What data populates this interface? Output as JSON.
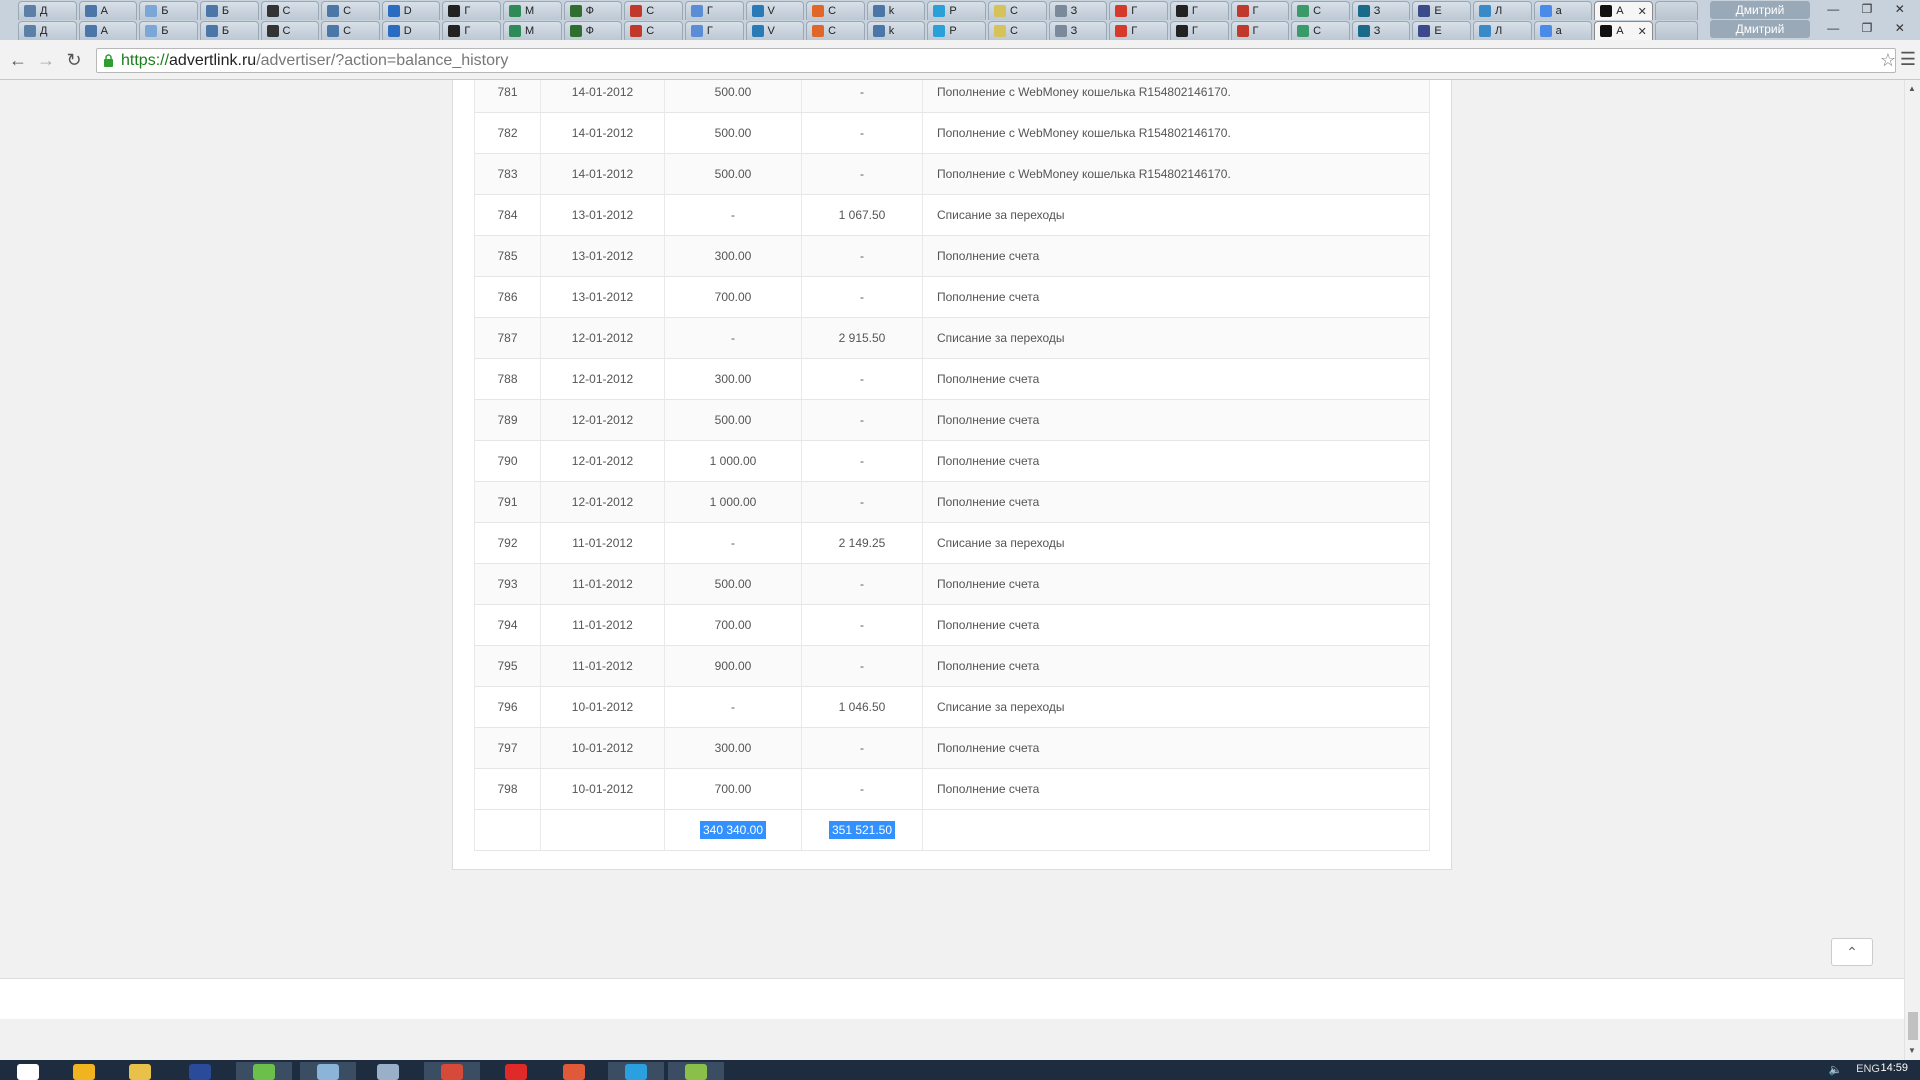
{
  "browser": {
    "tabs_row1": [
      {
        "label": "Д",
        "color": "#5b7fa6"
      },
      {
        "label": "А",
        "color": "#4a76a8"
      },
      {
        "label": "Б",
        "color": "#7aa7d8"
      },
      {
        "label": "Б",
        "color": "#4a76a8"
      },
      {
        "label": "С",
        "color": "#333333"
      },
      {
        "label": "С",
        "color": "#4a76a8"
      },
      {
        "label": "D",
        "color": "#2a6cc2"
      },
      {
        "label": "Г",
        "color": "#222222"
      },
      {
        "label": "М",
        "color": "#2e8b57"
      },
      {
        "label": "Ф",
        "color": "#2f6e2f"
      },
      {
        "label": "С",
        "color": "#c0392b"
      },
      {
        "label": "Г",
        "color": "#5b8dd6"
      },
      {
        "label": "V",
        "color": "#2a7ab8"
      },
      {
        "label": "С",
        "color": "#e0662a"
      },
      {
        "label": "k",
        "color": "#4a76a8"
      },
      {
        "label": "Р",
        "color": "#2aa0d8"
      },
      {
        "label": "С",
        "color": "#d6c25b"
      },
      {
        "label": "З",
        "color": "#7a8a9a"
      },
      {
        "label": "Г",
        "color": "#d63a2a"
      },
      {
        "label": "Г",
        "color": "#222222"
      },
      {
        "label": "Г",
        "color": "#c0392b"
      },
      {
        "label": "С",
        "color": "#3a9a6a"
      },
      {
        "label": "З",
        "color": "#1a6a8a"
      },
      {
        "label": "E",
        "color": "#3a4a8a"
      },
      {
        "label": "Л",
        "color": "#3a8ac8"
      },
      {
        "label": "а",
        "color": "#4a8ae8"
      },
      {
        "label": "А",
        "color": "#111111"
      }
    ],
    "tabs_row2": [
      {
        "label": "Д",
        "color": "#5b7fa6"
      },
      {
        "label": "А",
        "color": "#4a76a8"
      },
      {
        "label": "Б",
        "color": "#7aa7d8"
      },
      {
        "label": "Б",
        "color": "#4a76a8"
      },
      {
        "label": "С",
        "color": "#333333"
      },
      {
        "label": "С",
        "color": "#4a76a8"
      },
      {
        "label": "D",
        "color": "#2a6cc2"
      },
      {
        "label": "Г",
        "color": "#222222"
      },
      {
        "label": "М",
        "color": "#2e8b57"
      },
      {
        "label": "Ф",
        "color": "#2f6e2f"
      },
      {
        "label": "С",
        "color": "#c0392b"
      },
      {
        "label": "Г",
        "color": "#5b8dd6"
      },
      {
        "label": "V",
        "color": "#2a7ab8"
      },
      {
        "label": "С",
        "color": "#e0662a"
      },
      {
        "label": "k",
        "color": "#4a76a8"
      },
      {
        "label": "Р",
        "color": "#2aa0d8"
      },
      {
        "label": "С",
        "color": "#d6c25b"
      },
      {
        "label": "З",
        "color": "#7a8a9a"
      },
      {
        "label": "Г",
        "color": "#d63a2a"
      },
      {
        "label": "Г",
        "color": "#222222"
      },
      {
        "label": "Г",
        "color": "#c0392b"
      },
      {
        "label": "С",
        "color": "#3a9a6a"
      },
      {
        "label": "З",
        "color": "#1a6a8a"
      },
      {
        "label": "E",
        "color": "#3a4a8a"
      },
      {
        "label": "Л",
        "color": "#3a8ac8"
      },
      {
        "label": "а",
        "color": "#4a8ae8"
      },
      {
        "label": "А",
        "color": "#111111"
      }
    ],
    "user_name": "Дмитрий",
    "url_scheme": "https://",
    "url_domain": "advertlink.ru",
    "url_path": "/advertiser/?action=balance_history"
  },
  "table": {
    "rows": [
      {
        "id": "781",
        "date": "14-01-2012",
        "credit": "500.00",
        "debit": "-",
        "desc": "Пополнение с WebMoney кошелька R154802146170."
      },
      {
        "id": "782",
        "date": "14-01-2012",
        "credit": "500.00",
        "debit": "-",
        "desc": "Пополнение с WebMoney кошелька R154802146170."
      },
      {
        "id": "783",
        "date": "14-01-2012",
        "credit": "500.00",
        "debit": "-",
        "desc": "Пополнение с WebMoney кошелька R154802146170."
      },
      {
        "id": "784",
        "date": "13-01-2012",
        "credit": "-",
        "debit": "1 067.50",
        "desc": "Списание за переходы"
      },
      {
        "id": "785",
        "date": "13-01-2012",
        "credit": "300.00",
        "debit": "-",
        "desc": "Пополнение счета"
      },
      {
        "id": "786",
        "date": "13-01-2012",
        "credit": "700.00",
        "debit": "-",
        "desc": "Пополнение счета"
      },
      {
        "id": "787",
        "date": "12-01-2012",
        "credit": "-",
        "debit": "2 915.50",
        "desc": "Списание за переходы"
      },
      {
        "id": "788",
        "date": "12-01-2012",
        "credit": "300.00",
        "debit": "-",
        "desc": "Пополнение счета"
      },
      {
        "id": "789",
        "date": "12-01-2012",
        "credit": "500.00",
        "debit": "-",
        "desc": "Пополнение счета"
      },
      {
        "id": "790",
        "date": "12-01-2012",
        "credit": "1 000.00",
        "debit": "-",
        "desc": "Пополнение счета"
      },
      {
        "id": "791",
        "date": "12-01-2012",
        "credit": "1 000.00",
        "debit": "-",
        "desc": "Пополнение счета"
      },
      {
        "id": "792",
        "date": "11-01-2012",
        "credit": "-",
        "debit": "2 149.25",
        "desc": "Списание за переходы"
      },
      {
        "id": "793",
        "date": "11-01-2012",
        "credit": "500.00",
        "debit": "-",
        "desc": "Пополнение счета"
      },
      {
        "id": "794",
        "date": "11-01-2012",
        "credit": "700.00",
        "debit": "-",
        "desc": "Пополнение счета"
      },
      {
        "id": "795",
        "date": "11-01-2012",
        "credit": "900.00",
        "debit": "-",
        "desc": "Пополнение счета"
      },
      {
        "id": "796",
        "date": "10-01-2012",
        "credit": "-",
        "debit": "1 046.50",
        "desc": "Списание за переходы"
      },
      {
        "id": "797",
        "date": "10-01-2012",
        "credit": "300.00",
        "debit": "-",
        "desc": "Пополнение счета"
      },
      {
        "id": "798",
        "date": "10-01-2012",
        "credit": "700.00",
        "debit": "-",
        "desc": "Пополнение счета"
      }
    ],
    "total_credit": "340 340.00",
    "total_debit": "351 521.50"
  },
  "taskbar": {
    "icons": [
      {
        "name": "start",
        "color": "#ffffff",
        "active": false
      },
      {
        "name": "ie",
        "color": "#f0b41e",
        "active": false
      },
      {
        "name": "explorer",
        "color": "#e8c04a",
        "active": false
      },
      {
        "name": "save",
        "color": "#2a4a9a",
        "active": false
      },
      {
        "name": "app-green",
        "color": "#6ac04a",
        "active": true
      },
      {
        "name": "app-blue",
        "color": "#8ab4d8",
        "active": true
      },
      {
        "name": "app-window",
        "color": "#9ab0c8",
        "active": false
      },
      {
        "name": "chrome",
        "color": "#d64a3a",
        "active": true
      },
      {
        "name": "yandex",
        "color": "#e02a2a",
        "active": false
      },
      {
        "name": "grid",
        "color": "#e05a3a",
        "active": false
      },
      {
        "name": "telegram",
        "color": "#2aa0e0",
        "active": true
      },
      {
        "name": "paint",
        "color": "#8ac04a",
        "active": true
      }
    ],
    "lang": "ENG",
    "time": "14:59"
  }
}
